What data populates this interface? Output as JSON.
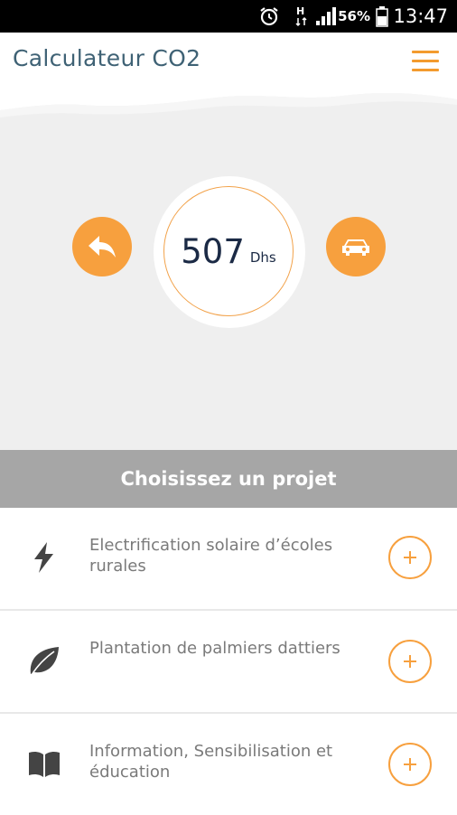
{
  "status_bar": {
    "time": "13:47",
    "battery_percent": "56%",
    "icons": [
      "alarm-icon",
      "data-arrows-icon",
      "signal-icon",
      "battery-icon"
    ]
  },
  "app_bar": {
    "title": "Calculateur CO2",
    "menu_icon": "hamburger-menu-icon",
    "accent_color": "#f39b2e"
  },
  "calculator": {
    "amount": "507",
    "currency": "Dhs",
    "back_icon": "reply-arrow-icon",
    "car_icon": "car-icon"
  },
  "section": {
    "title": "Choisissez un projet"
  },
  "projects": [
    {
      "label": "Electrification solaire d’écoles rurales",
      "icon": "lightning-bolt-icon"
    },
    {
      "label": "Plantation de palmiers dattiers",
      "icon": "leaf-icon"
    },
    {
      "label": "Information, Sensibilisation et éducation",
      "icon": "open-book-icon"
    }
  ],
  "colors": {
    "accent": "#f7a03e",
    "title": "#3f6275",
    "amount": "#1b2a45",
    "header_bg": "#a6a6a6"
  }
}
